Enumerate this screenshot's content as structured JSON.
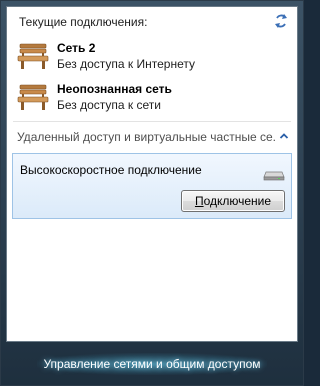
{
  "panel": {
    "header": "Текущие подключения:"
  },
  "networks": [
    {
      "name": "Сеть  2",
      "status": "Без доступа к Интернету"
    },
    {
      "name": "Неопознанная сеть",
      "status": "Без доступа к сети"
    }
  ],
  "remote_section": {
    "title": "Удаленный доступ и виртуальные частные се...",
    "connections": [
      {
        "name": "Высокоскоростное подключение",
        "button_label": "Подключение"
      }
    ]
  },
  "footer": {
    "link_label": "Управление сетями и общим доступом"
  },
  "icons": {
    "refresh": "refresh-icon",
    "network": "bench-network-icon",
    "collapse": "chevron-up-icon",
    "modem": "modem-icon"
  }
}
